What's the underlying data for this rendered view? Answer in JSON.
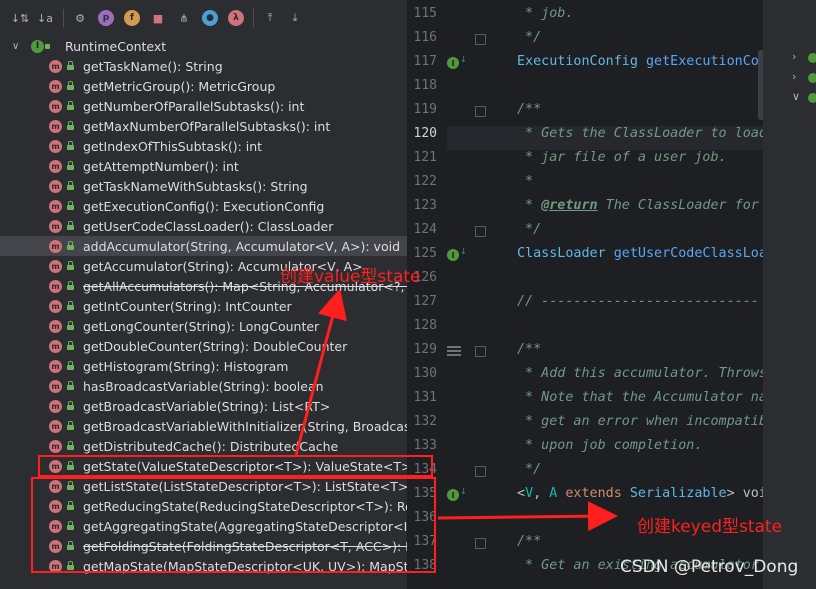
{
  "toolbar": {
    "icons": [
      "sort-by-type-icon",
      "sort-alpha-icon",
      "class-filter-icon",
      "property-filter-icon",
      "field-filter-icon",
      "lock-filter-icon",
      "hierarchy-icon",
      "circle-filter-icon",
      "lambda-filter-icon",
      "expand-icon",
      "collapse-icon"
    ],
    "letters": [
      "p",
      "f",
      "λ"
    ]
  },
  "structure": {
    "root": {
      "label": "RuntimeContext",
      "icon_letter": "I"
    },
    "method_icon_letter": "m",
    "methods": [
      {
        "label": "getTaskName(): String",
        "strike": false
      },
      {
        "label": "getMetricGroup(): MetricGroup",
        "strike": false
      },
      {
        "label": "getNumberOfParallelSubtasks(): int",
        "strike": false
      },
      {
        "label": "getMaxNumberOfParallelSubtasks(): int",
        "strike": false
      },
      {
        "label": "getIndexOfThisSubtask(): int",
        "strike": false
      },
      {
        "label": "getAttemptNumber(): int",
        "strike": false
      },
      {
        "label": "getTaskNameWithSubtasks(): String",
        "strike": false
      },
      {
        "label": "getExecutionConfig(): ExecutionConfig",
        "strike": false
      },
      {
        "label": "getUserCodeClassLoader(): ClassLoader",
        "strike": false
      },
      {
        "label": "addAccumulator(String, Accumulator<V, A>): void",
        "strike": false,
        "selected": true
      },
      {
        "label": "getAccumulator(String): Accumulator<V, A>",
        "strike": false
      },
      {
        "label": "getAllAccumulators(): Map<String, Accumulator<?, ?>>",
        "strike": true
      },
      {
        "label": "getIntCounter(String): IntCounter",
        "strike": false
      },
      {
        "label": "getLongCounter(String): LongCounter",
        "strike": false
      },
      {
        "label": "getDoubleCounter(String): DoubleCounter",
        "strike": false
      },
      {
        "label": "getHistogram(String): Histogram",
        "strike": false
      },
      {
        "label": "hasBroadcastVariable(String): boolean",
        "strike": false
      },
      {
        "label": "getBroadcastVariable(String): List<RT>",
        "strike": false
      },
      {
        "label": "getBroadcastVariableWithInitializer(String, BroadcastVa",
        "strike": false
      },
      {
        "label": "getDistributedCache(): DistributedCache",
        "strike": false
      },
      {
        "label": "getState(ValueStateDescriptor<T>): ValueState<T>",
        "strike": false
      },
      {
        "label": "getListState(ListStateDescriptor<T>): ListState<T>",
        "strike": false
      },
      {
        "label": "getReducingState(ReducingStateDescriptor<T>): Reduci",
        "strike": false
      },
      {
        "label": "getAggregatingState(AggregatingStateDescriptor<IN, A",
        "strike": false
      },
      {
        "label": "getFoldingState(FoldingStateDescriptor<T, ACC>): Foldi",
        "strike": true
      },
      {
        "label": "getMapState(MapStateDescriptor<UK, UV>): MapState",
        "strike": false
      }
    ]
  },
  "editor": {
    "current_line": "120",
    "lines": [
      {
        "num": "115",
        "parts": [
          {
            "c": "cm",
            "t": " * job."
          }
        ]
      },
      {
        "num": "116",
        "parts": [
          {
            "c": "cm",
            "t": " */"
          }
        ]
      },
      {
        "num": "117",
        "parts": [
          {
            "c": "ty",
            "t": "ExecutionConfig"
          },
          {
            "c": "pl",
            "t": " "
          },
          {
            "c": "fn",
            "t": "getExecutionCon"
          }
        ]
      },
      {
        "num": "118",
        "parts": []
      },
      {
        "num": "119",
        "parts": [
          {
            "c": "cm",
            "t": "/**"
          }
        ]
      },
      {
        "num": "120",
        "parts": [
          {
            "c": "cm",
            "t": " * Gets the ClassLoader to load"
          }
        ]
      },
      {
        "num": "121",
        "parts": [
          {
            "c": "cm",
            "t": " * jar file of a user job."
          }
        ]
      },
      {
        "num": "122",
        "parts": [
          {
            "c": "cm",
            "t": " *"
          }
        ]
      },
      {
        "num": "123",
        "parts": [
          {
            "c": "cm",
            "t": " * "
          },
          {
            "c": "cm-tag",
            "t": "@return"
          },
          {
            "c": "cm",
            "t": " The ClassLoader for"
          }
        ]
      },
      {
        "num": "124",
        "parts": [
          {
            "c": "cm",
            "t": " */"
          }
        ]
      },
      {
        "num": "125",
        "parts": [
          {
            "c": "ty",
            "t": "ClassLoader"
          },
          {
            "c": "pl",
            "t": " "
          },
          {
            "c": "fn",
            "t": "getUserCodeClassLoa"
          }
        ]
      },
      {
        "num": "126",
        "parts": []
      },
      {
        "num": "127",
        "parts": [
          {
            "c": "cm",
            "t": "// ---------------------------"
          }
        ]
      },
      {
        "num": "128",
        "parts": []
      },
      {
        "num": "129",
        "parts": [
          {
            "c": "cm",
            "t": "/**"
          }
        ]
      },
      {
        "num": "130",
        "parts": [
          {
            "c": "cm",
            "t": " * Add this accumulator. Throws"
          }
        ]
      },
      {
        "num": "131",
        "parts": [
          {
            "c": "cm",
            "t": " * Note that the Accumulator na"
          }
        ]
      },
      {
        "num": "132",
        "parts": [
          {
            "c": "cm",
            "t": " * get an error when incompatib"
          }
        ]
      },
      {
        "num": "133",
        "parts": [
          {
            "c": "cm",
            "t": " * upon job completion."
          }
        ]
      },
      {
        "num": "134",
        "parts": [
          {
            "c": "cm",
            "t": " */"
          }
        ]
      },
      {
        "num": "135",
        "parts": [
          {
            "c": "pl",
            "t": "<"
          },
          {
            "c": "gen",
            "t": "V"
          },
          {
            "c": "pl",
            "t": ", "
          },
          {
            "c": "gen",
            "t": "A"
          },
          {
            "c": "pl",
            "t": " "
          },
          {
            "c": "kw",
            "t": "extends"
          },
          {
            "c": "pl",
            "t": " "
          },
          {
            "c": "ty",
            "t": "Serializable"
          },
          {
            "c": "pl",
            "t": "> voi"
          }
        ]
      },
      {
        "num": "136",
        "parts": []
      },
      {
        "num": "137",
        "parts": [
          {
            "c": "cm",
            "t": "/**"
          }
        ]
      },
      {
        "num": "138",
        "parts": [
          {
            "c": "cm",
            "t": " * Get an existing accumulator"
          }
        ]
      }
    ]
  },
  "annotations": {
    "value_state": "创建value型state",
    "keyed_state": "创建keyed型state",
    "annotation_color": "#ff1f1f"
  },
  "watermark": "CSDN @Petrov_Dong"
}
